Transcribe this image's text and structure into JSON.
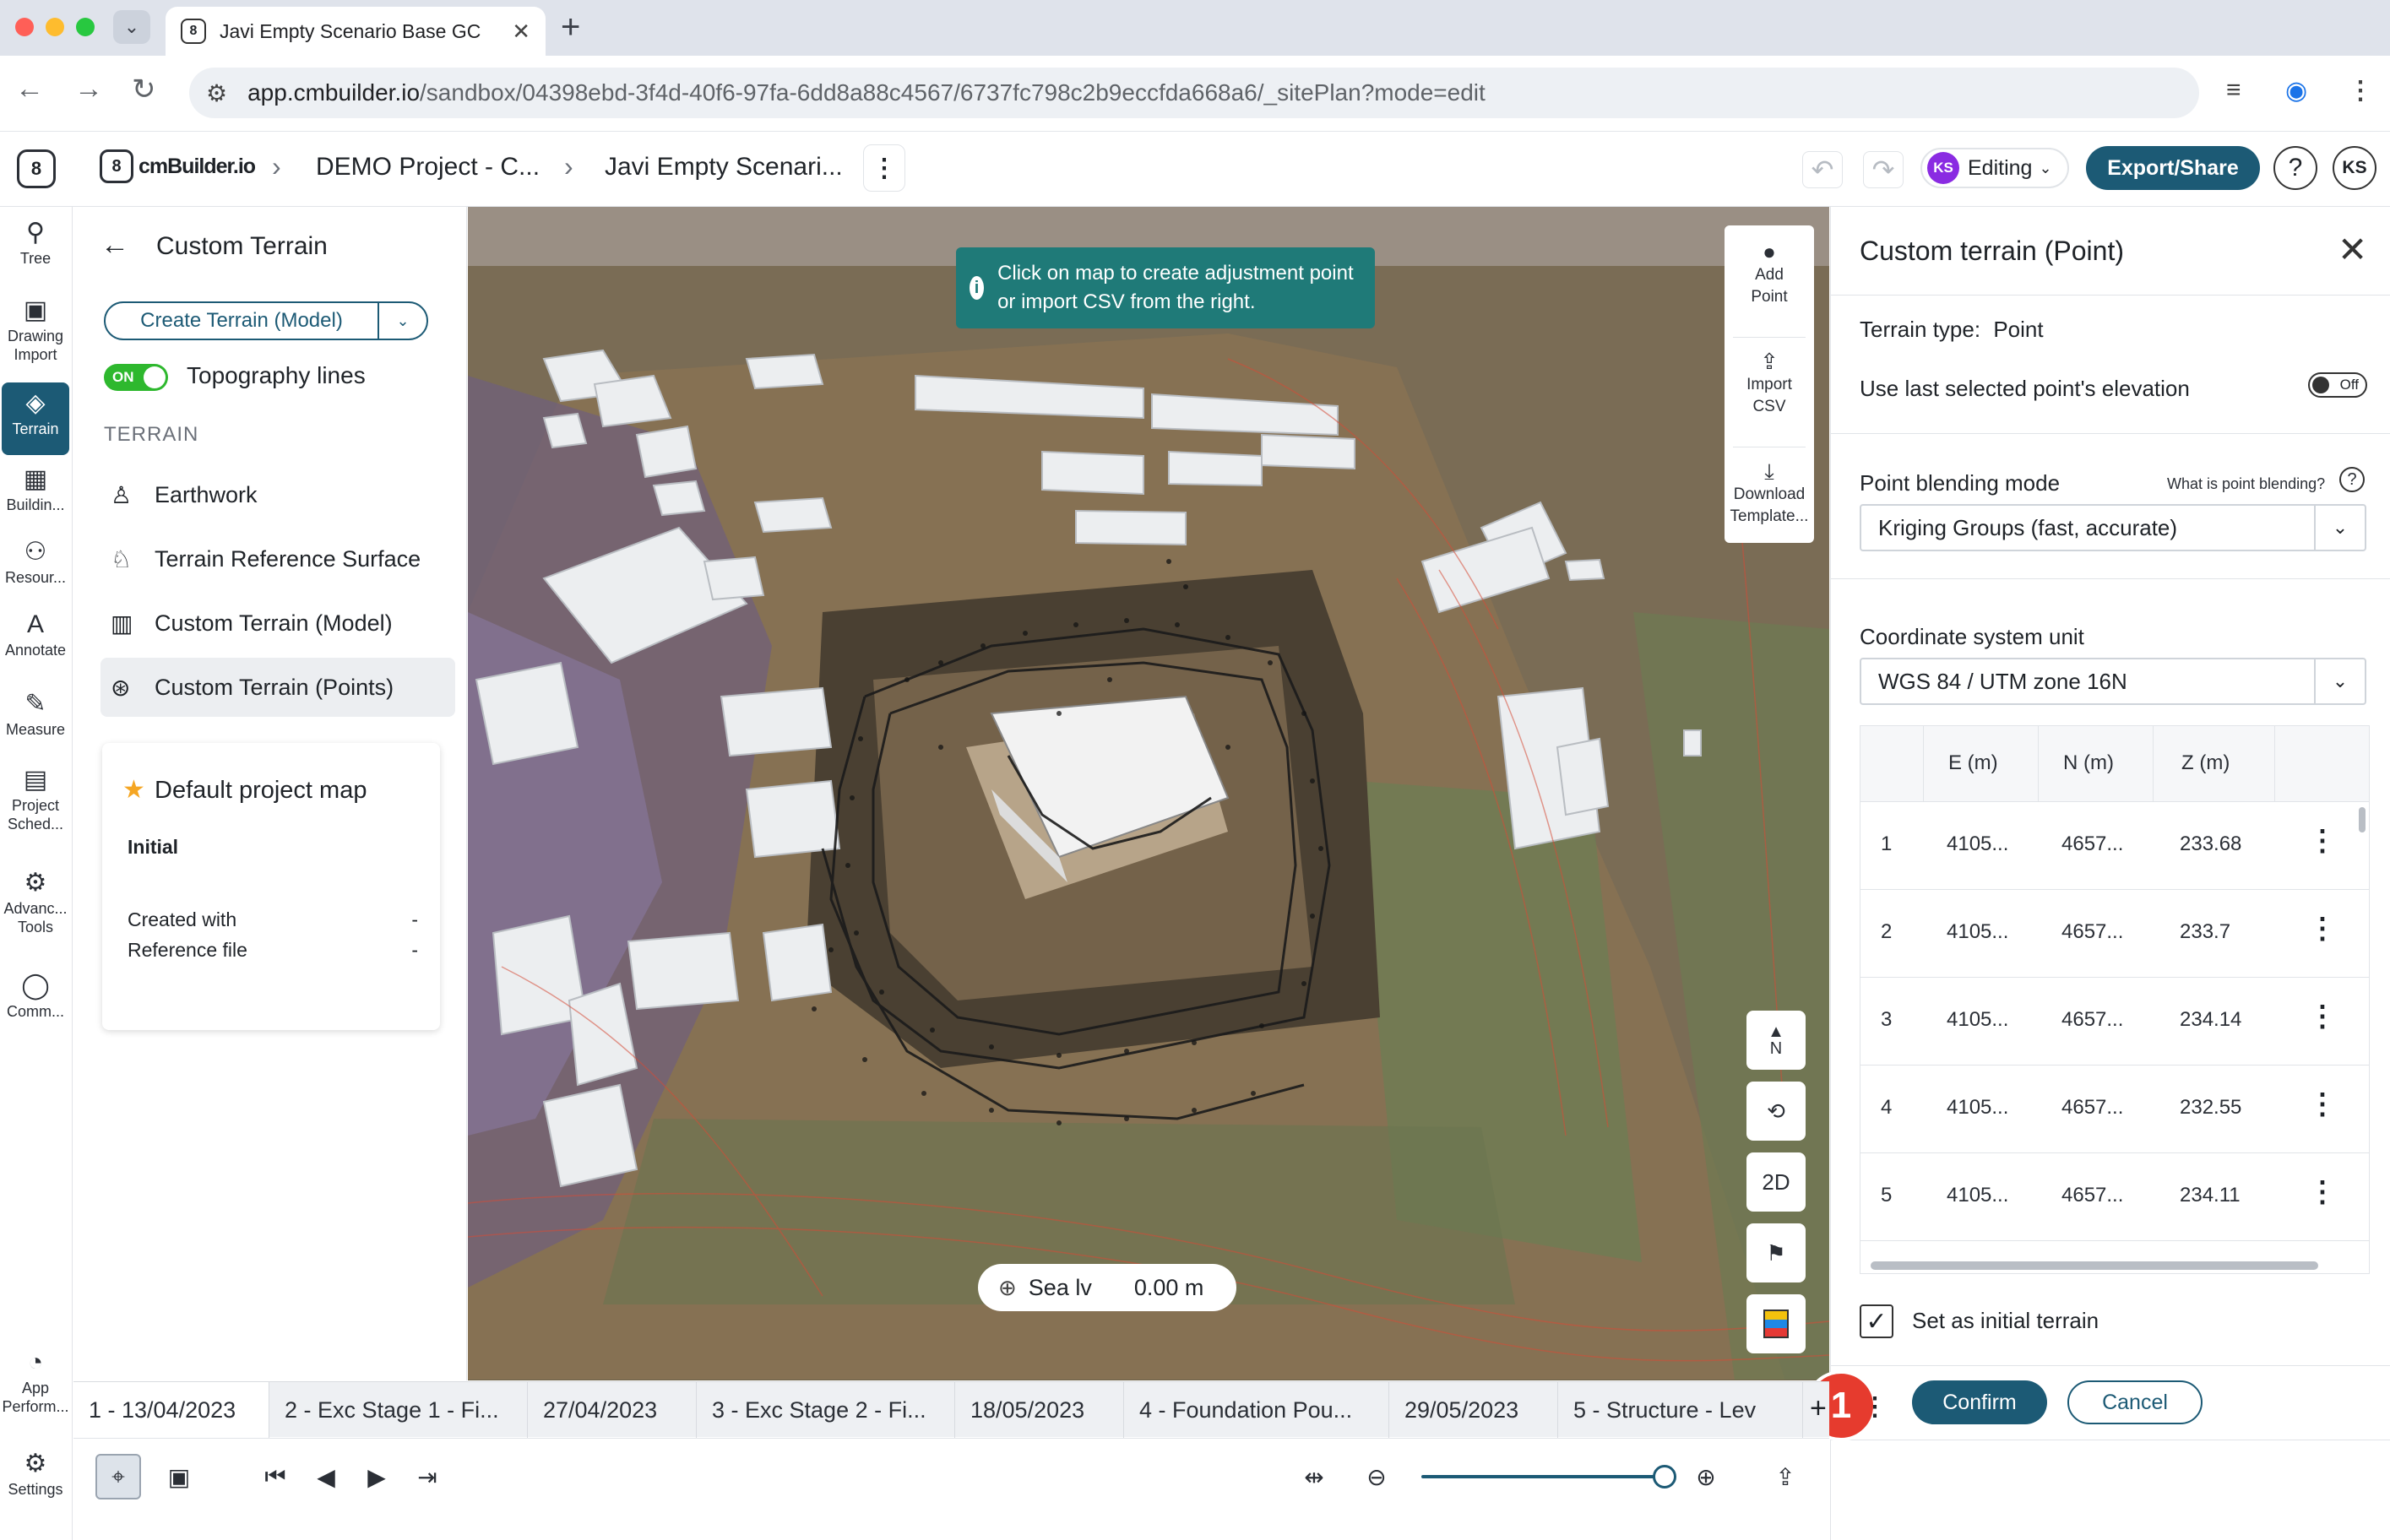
{
  "browser": {
    "tab_title": "Javi Empty Scenario Base GC",
    "url_host": "app.cmbuilder.io",
    "url_path": "/sandbox/04398ebd-3f4d-40f6-97fa-6dd8a88c4567/6737fc798c2b9eccfda668a6/_sitePlan?mode=edit"
  },
  "header": {
    "brand": "cmBuilder.io",
    "rail_logo": "8",
    "breadcrumb_project": "DEMO Project - C...",
    "breadcrumb_scenario": "Javi Empty Scenari...",
    "user_initials": "KS",
    "mode_label": "Editing",
    "export_label": "Export/Share",
    "help_label": "?"
  },
  "rail": {
    "items": [
      {
        "label": "Tree",
        "icon": "tree-icon"
      },
      {
        "label": "Drawing Import",
        "icon": "drawing-import-icon"
      },
      {
        "label": "Terrain",
        "icon": "terrain-icon"
      },
      {
        "label": "Buildin...",
        "icon": "building-icon"
      },
      {
        "label": "Resour...",
        "icon": "resources-icon"
      },
      {
        "label": "Annotate",
        "icon": "annotate-icon"
      },
      {
        "label": "Measure",
        "icon": "measure-icon"
      },
      {
        "label": "Project Sched...",
        "icon": "schedule-icon"
      },
      {
        "label": "Advanc... Tools",
        "icon": "tools-icon"
      },
      {
        "label": "Comm...",
        "icon": "comment-icon"
      },
      {
        "label": "App Perform...",
        "icon": "performance-icon"
      },
      {
        "label": "Settings",
        "icon": "gear-icon"
      }
    ]
  },
  "left_panel": {
    "title": "Custom Terrain",
    "create_button": "Create Terrain (Model)",
    "toggle_state": "ON",
    "topo_label": "Topography lines",
    "section": "TERRAIN",
    "items": [
      {
        "label": "Earthwork",
        "icon": "earthwork-icon"
      },
      {
        "label": "Terrain Reference Surface",
        "icon": "reference-surface-icon"
      },
      {
        "label": "Custom Terrain (Model)",
        "icon": "model-icon"
      },
      {
        "label": "Custom Terrain (Points)",
        "icon": "points-icon"
      }
    ],
    "map_card": {
      "name": "Default project map",
      "status": "Initial",
      "created_with_label": "Created with",
      "created_with_value": "-",
      "reference_label": "Reference file",
      "reference_value": "-"
    }
  },
  "map": {
    "toast": "Click on map to create adjustment point or import CSV from the right.",
    "tools": [
      {
        "label": "Add Point",
        "icon": "dot-icon"
      },
      {
        "label": "Import CSV",
        "icon": "upload-icon"
      },
      {
        "label": "Download Template...",
        "icon": "download-icon"
      }
    ],
    "compass": "N",
    "view_2d": "2D",
    "sea_level_label": "Sea lv",
    "sea_level_value": "0.00 m"
  },
  "right_panel": {
    "title": "Custom terrain (Point)",
    "terrain_type_label": "Terrain type:",
    "terrain_type_value": "Point",
    "use_last_label": "Use last selected point's elevation",
    "use_last_toggle": "Off",
    "blending_label": "Point blending mode",
    "blending_help": "What is point blending?",
    "blending_value": "Kriging Groups (fast, accurate)",
    "coord_label": "Coordinate system unit",
    "coord_value": "WGS 84 / UTM zone 16N",
    "columns": [
      "E (m)",
      "N (m)",
      "Z (m)"
    ],
    "rows": [
      {
        "idx": "1",
        "e": "4105...",
        "n": "4657...",
        "z": "233.68"
      },
      {
        "idx": "2",
        "e": "4105...",
        "n": "4657...",
        "z": "233.7"
      },
      {
        "idx": "3",
        "e": "4105...",
        "n": "4657...",
        "z": "234.14"
      },
      {
        "idx": "4",
        "e": "4105...",
        "n": "4657...",
        "z": "232.55"
      },
      {
        "idx": "5",
        "e": "4105...",
        "n": "4657...",
        "z": "234.11"
      }
    ],
    "initial_terrain_label": "Set as initial terrain",
    "confirm_label": "Confirm",
    "cancel_label": "Cancel",
    "step_badge": "1"
  },
  "timeline": {
    "tabs": [
      "1 - 13/04/2023",
      "2 - Exc Stage 1 - Fi...",
      "27/04/2023",
      "3 - Exc Stage 2 - Fi...",
      "18/05/2023",
      "4 - Foundation Pou...",
      "29/05/2023",
      "5 - Structure - Lev"
    ],
    "zoom_level": 1.0
  },
  "colors": {
    "primary": "#1c5a75",
    "toast": "#1f7a78",
    "toggle_on": "#2eb82e",
    "badge": "#e63b2e",
    "avatar": "#8a2be2"
  }
}
